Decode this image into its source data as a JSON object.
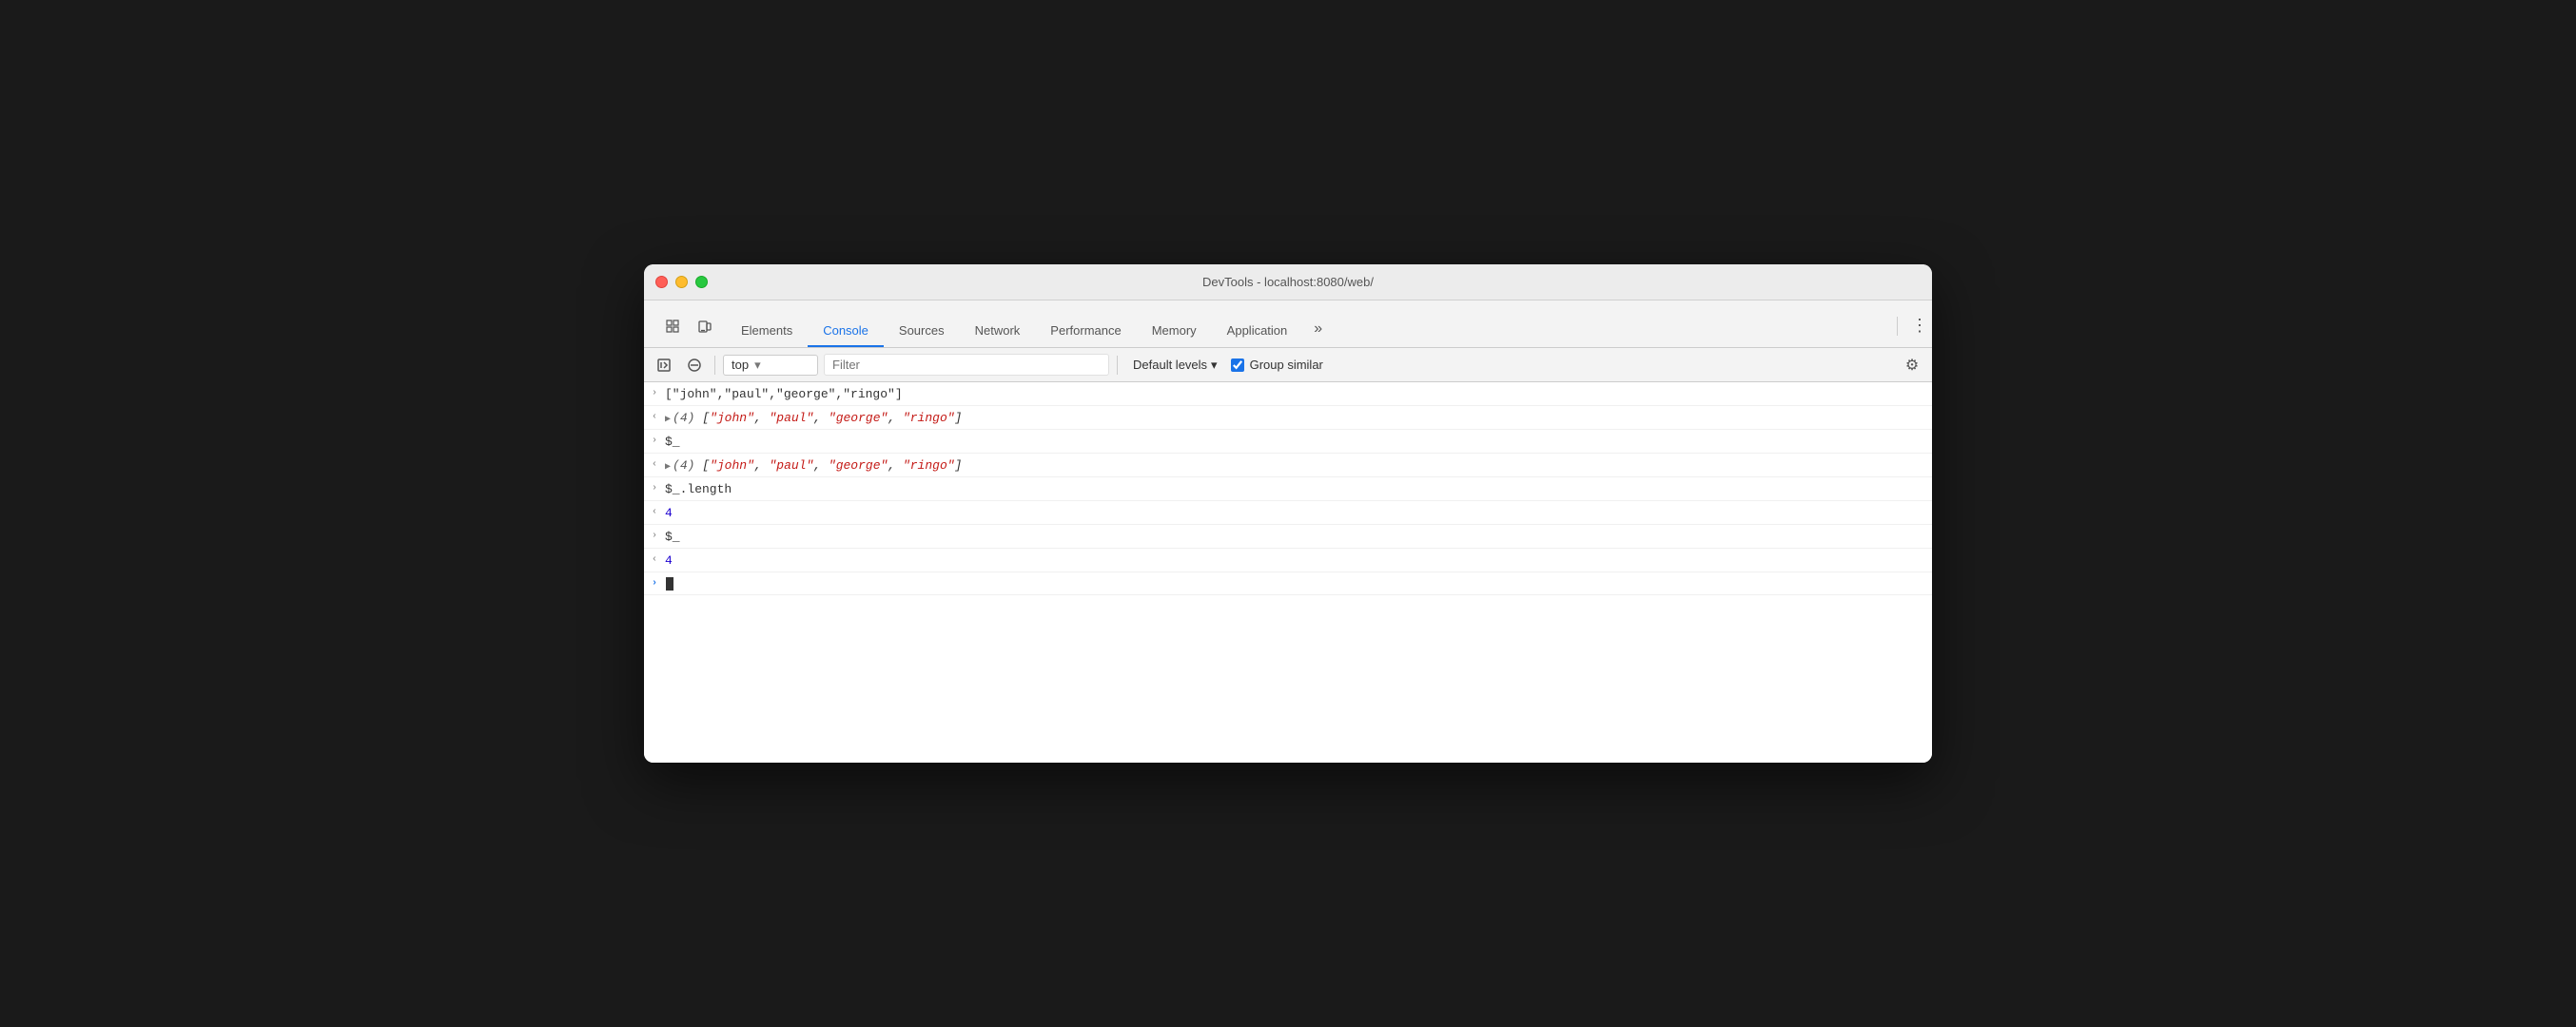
{
  "window": {
    "title": "DevTools - localhost:8080/web/"
  },
  "tabs": {
    "items": [
      {
        "id": "elements",
        "label": "Elements",
        "active": false
      },
      {
        "id": "console",
        "label": "Console",
        "active": true
      },
      {
        "id": "sources",
        "label": "Sources",
        "active": false
      },
      {
        "id": "network",
        "label": "Network",
        "active": false
      },
      {
        "id": "performance",
        "label": "Performance",
        "active": false
      },
      {
        "id": "memory",
        "label": "Memory",
        "active": false
      },
      {
        "id": "application",
        "label": "Application",
        "active": false
      }
    ],
    "more_label": "»",
    "settings_icon": "⚙"
  },
  "toolbar": {
    "context": "top",
    "context_dropdown": "▾",
    "filter_placeholder": "Filter",
    "levels_label": "Default levels",
    "levels_dropdown": "▾",
    "group_similar_label": "Group similar",
    "group_similar_checked": true,
    "settings_icon": "⚙"
  },
  "console_rows": [
    {
      "type": "input",
      "arrow": ">",
      "content": "[\"john\",\"paul\",\"george\",\"ringo\"]",
      "expandable": false
    },
    {
      "type": "output",
      "arrow": "<",
      "expandable": true,
      "prefix": "(4)",
      "items": [
        "\"john\"",
        "\"paul\"",
        "\"george\"",
        "\"ringo\""
      ]
    },
    {
      "type": "input",
      "arrow": ">",
      "content": "$_",
      "expandable": false
    },
    {
      "type": "output",
      "arrow": "<",
      "expandable": true,
      "prefix": "(4)",
      "items": [
        "\"john\"",
        "\"paul\"",
        "\"george\"",
        "\"ringo\""
      ]
    },
    {
      "type": "input",
      "arrow": ">",
      "content": "$_.length",
      "expandable": false
    },
    {
      "type": "output_num",
      "arrow": "<",
      "value": "4",
      "expandable": false
    },
    {
      "type": "input",
      "arrow": ">",
      "content": "$_",
      "expandable": false
    },
    {
      "type": "output_num",
      "arrow": "<",
      "value": "4",
      "expandable": false
    },
    {
      "type": "prompt",
      "arrow": ">",
      "expandable": false
    }
  ]
}
